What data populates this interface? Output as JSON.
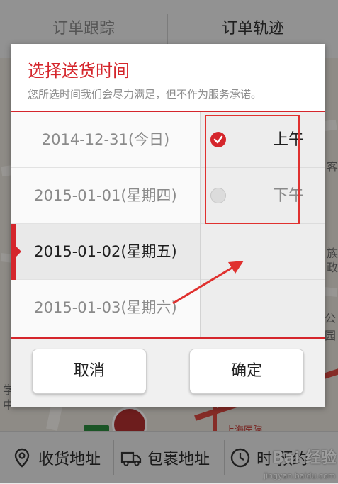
{
  "background": {
    "tabs": [
      "订单跟踪",
      "订单轨迹"
    ],
    "map_labels": [
      "学",
      "中",
      "客",
      "族",
      "政",
      "公园"
    ],
    "map_place": "上海医院",
    "bottom_bar": {
      "receive_address": "收货地址",
      "parcel_address": "包裹地址",
      "time_label": "时   预约"
    },
    "watermark": {
      "brand": "Bai 经验",
      "url": "jingyan.baidu.com"
    }
  },
  "dialog": {
    "title": "选择送货时间",
    "subtitle": "您所选时间我们会尽力满足，但不作为服务承诺。",
    "dates": [
      {
        "label": "2014-12-31(今日)",
        "selected": false
      },
      {
        "label": "2015-01-01(星期四)",
        "selected": false
      },
      {
        "label": "2015-01-02(星期五)",
        "selected": true
      },
      {
        "label": "2015-01-03(星期六)",
        "selected": false
      }
    ],
    "time_slots": [
      {
        "label": "上午",
        "checked": true
      },
      {
        "label": "下午",
        "checked": false
      }
    ],
    "cancel_label": "取消",
    "confirm_label": "确定"
  },
  "colors": {
    "accent": "#d5262c",
    "annotation": "#e0312f"
  }
}
